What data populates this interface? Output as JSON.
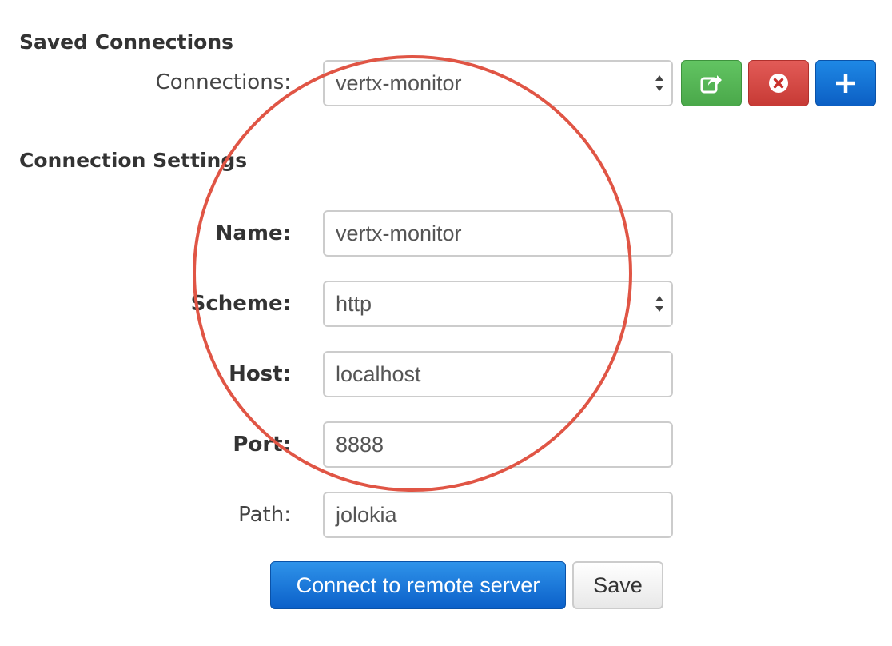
{
  "saved_connections": {
    "title": "Saved Connections",
    "connections_label": "Connections:",
    "selected_connection": "vertx-monitor",
    "buttons": {
      "connect_icon": "external-link-icon",
      "delete_icon": "remove-circle-icon",
      "add_icon": "plus-icon"
    }
  },
  "connection_settings": {
    "title": "Connection Settings",
    "name_label": "Name:",
    "name_value": "vertx-monitor",
    "scheme_label": "Scheme:",
    "scheme_value": "http",
    "host_label": "Host:",
    "host_value": "localhost",
    "port_label": "Port:",
    "port_value": "8888",
    "path_label": "Path:",
    "path_value": "jolokia"
  },
  "actions": {
    "connect_label": "Connect to remote server",
    "save_label": "Save"
  },
  "colors": {
    "green_button": "#4cae4c",
    "red_button": "#d2322d",
    "blue_button": "#0f6fd6",
    "annotation_circle": "#e05545"
  }
}
